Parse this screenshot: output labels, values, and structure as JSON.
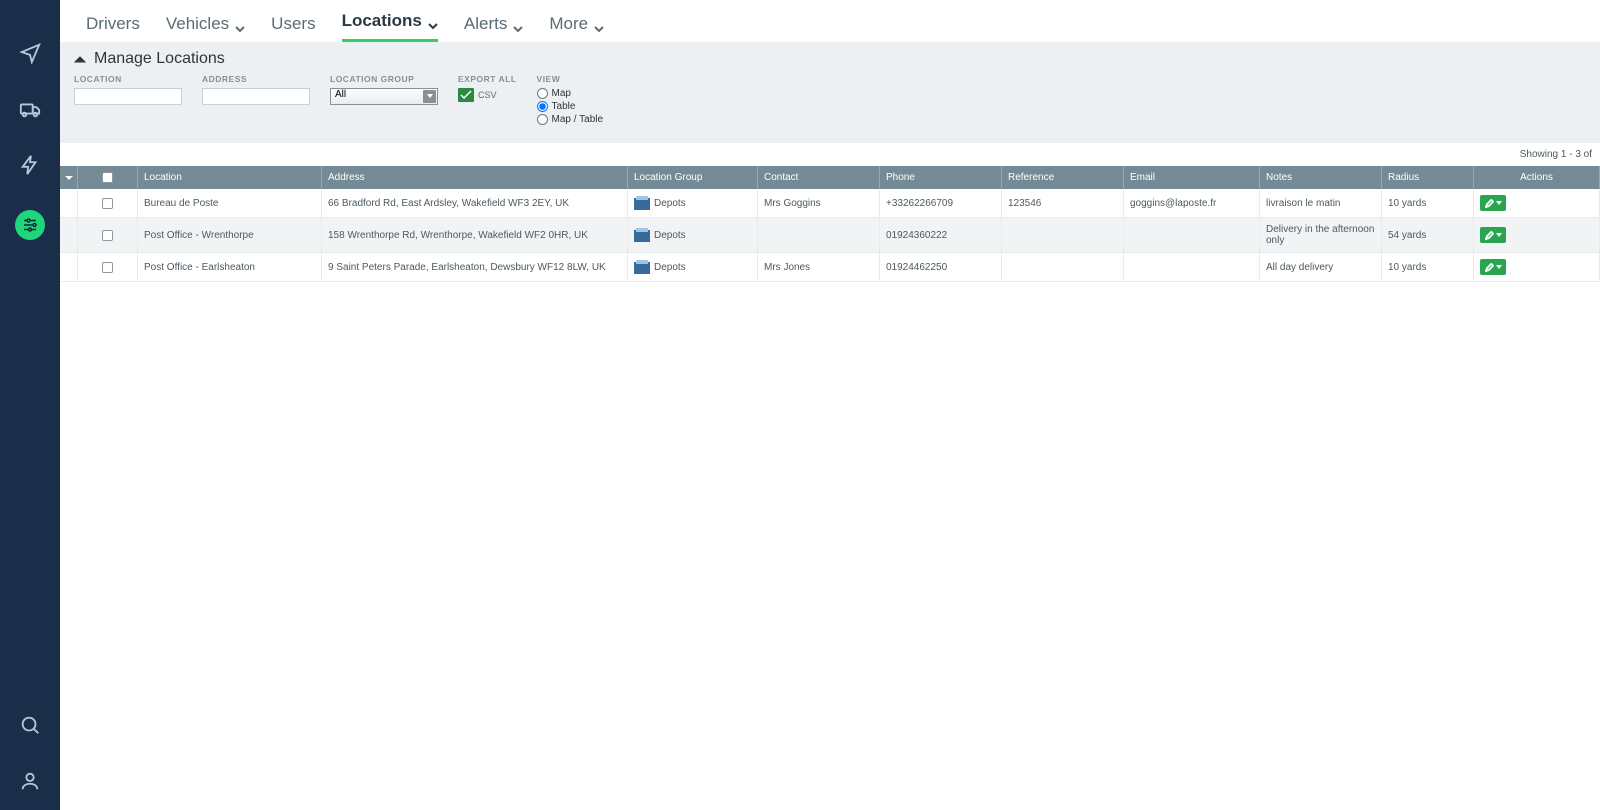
{
  "topnav": {
    "items": [
      {
        "label": "Drivers",
        "has_dropdown": false
      },
      {
        "label": "Vehicles",
        "has_dropdown": true
      },
      {
        "label": "Users",
        "has_dropdown": false
      },
      {
        "label": "Locations",
        "has_dropdown": true,
        "active": true
      },
      {
        "label": "Alerts",
        "has_dropdown": true
      },
      {
        "label": "More",
        "has_dropdown": true
      }
    ]
  },
  "filterbar": {
    "title": "Manage Locations",
    "labels": {
      "location": "LOCATION",
      "address": "ADDRESS",
      "location_group": "LOCATION GROUP",
      "export_all": "EXPORT ALL",
      "view": "VIEW"
    },
    "location_group_value": "All",
    "csv_label": "CSV",
    "view_options": {
      "map": "Map",
      "table": "Table",
      "map_table": "Map / Table"
    },
    "view_selected": "table"
  },
  "statusline": "Showing 1 - 3 of",
  "table": {
    "headers": {
      "location": "Location",
      "address": "Address",
      "location_group": "Location Group",
      "contact": "Contact",
      "phone": "Phone",
      "reference": "Reference",
      "email": "Email",
      "notes": "Notes",
      "radius": "Radius",
      "actions": "Actions"
    },
    "group_label": "Depots",
    "rows": [
      {
        "location": "Bureau de Poste",
        "address": "66 Bradford Rd, East Ardsley, Wakefield WF3 2EY, UK",
        "contact": "Mrs Goggins",
        "phone": "+33262266709",
        "reference": "123546",
        "email": "goggins@laposte.fr",
        "notes": "livraison le matin",
        "radius": "10 yards"
      },
      {
        "location": "Post Office - Wrenthorpe",
        "address": "158 Wrenthorpe Rd, Wrenthorpe, Wakefield WF2 0HR, UK",
        "contact": "",
        "phone": "01924360222",
        "reference": "",
        "email": "",
        "notes": "Delivery in the afternoon only",
        "radius": "54 yards"
      },
      {
        "location": "Post Office - Earlsheaton",
        "address": "9 Saint Peters Parade, Earlsheaton, Dewsbury WF12 8LW, UK",
        "contact": "Mrs Jones",
        "phone": "01924462250",
        "reference": "",
        "email": "",
        "notes": "All day delivery",
        "radius": "10 yards"
      }
    ]
  }
}
